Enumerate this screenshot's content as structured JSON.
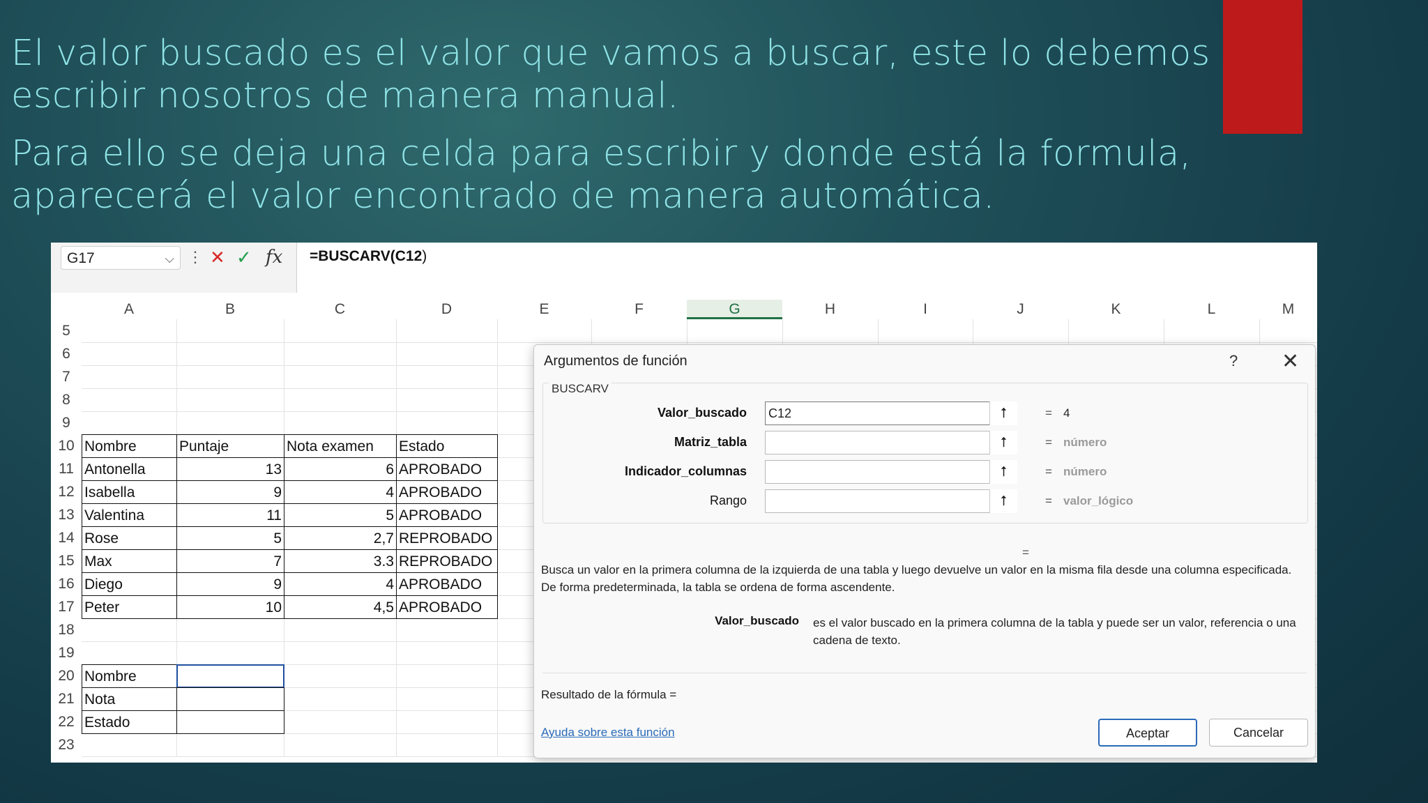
{
  "slide": {
    "paragraph1": "El valor buscado es el valor  que vamos a buscar, este lo debemos escribir nosotros de manera manual.",
    "paragraph2": "Para ello se deja una celda para escribir y donde está la formula, aparecerá el valor encontrado de manera automática."
  },
  "formula_bar": {
    "name_box": "G17",
    "formula_prefix": "=BUSCARV(",
    "formula_arg": "C12",
    "formula_suffix": ")"
  },
  "columns": [
    "A",
    "B",
    "C",
    "D",
    "E",
    "F",
    "G",
    "H",
    "I",
    "J",
    "K",
    "L",
    "M"
  ],
  "row_numbers": [
    "5",
    "6",
    "7",
    "8",
    "9",
    "10",
    "11",
    "12",
    "13",
    "14",
    "15",
    "16",
    "17",
    "18",
    "19",
    "20",
    "21",
    "22",
    "23"
  ],
  "table": {
    "headers": [
      "Nombre",
      "Puntaje",
      "Nota examen",
      "Estado"
    ],
    "rows": [
      [
        "Antonella",
        "13",
        "6",
        "APROBADO"
      ],
      [
        "Isabella",
        "9",
        "4",
        "APROBADO"
      ],
      [
        "Valentina",
        "11",
        "5",
        "APROBADO"
      ],
      [
        "Rose",
        "5",
        "2,7",
        "REPROBADO"
      ],
      [
        "Max",
        "7",
        "3.3",
        "REPROBADO"
      ],
      [
        "Diego",
        "9",
        "4",
        "APROBADO"
      ],
      [
        "Peter",
        "10",
        "4,5",
        "APROBADO"
      ]
    ]
  },
  "lookup": {
    "labels": [
      "Nombre",
      "Nota",
      "Estado"
    ]
  },
  "dialog": {
    "title": "Argumentos de función",
    "help": "?",
    "function_name": "BUSCARV",
    "args": [
      {
        "label": "Valor_buscado",
        "value": "C12",
        "result": "4",
        "bold": true
      },
      {
        "label": "Matriz_tabla",
        "value": "",
        "result": "número",
        "bold": true
      },
      {
        "label": "Indicador_columnas",
        "value": "",
        "result": "número",
        "bold": true
      },
      {
        "label": "Rango",
        "value": "",
        "result": "valor_lógico",
        "bold": false
      }
    ],
    "equals": "=",
    "description": "Busca un valor en la primera columna de la izquierda de una tabla y luego devuelve un valor en la misma fila desde una columna especificada. De forma predeterminada, la tabla se ordena de forma ascendente.",
    "param_name": "Valor_buscado",
    "param_desc": "es el valor buscado en la primera columna de la tabla y puede ser un valor, referencia o una cadena de texto.",
    "result_label": "Resultado de la fórmula =",
    "help_link": "Ayuda sobre esta función",
    "ok": "Aceptar",
    "cancel": "Cancelar"
  },
  "colors": {
    "slide_text": "#8fe3e6",
    "accent_red": "#bd1a1c",
    "excel_green": "#1e7145",
    "link_blue": "#2a6ab8"
  }
}
